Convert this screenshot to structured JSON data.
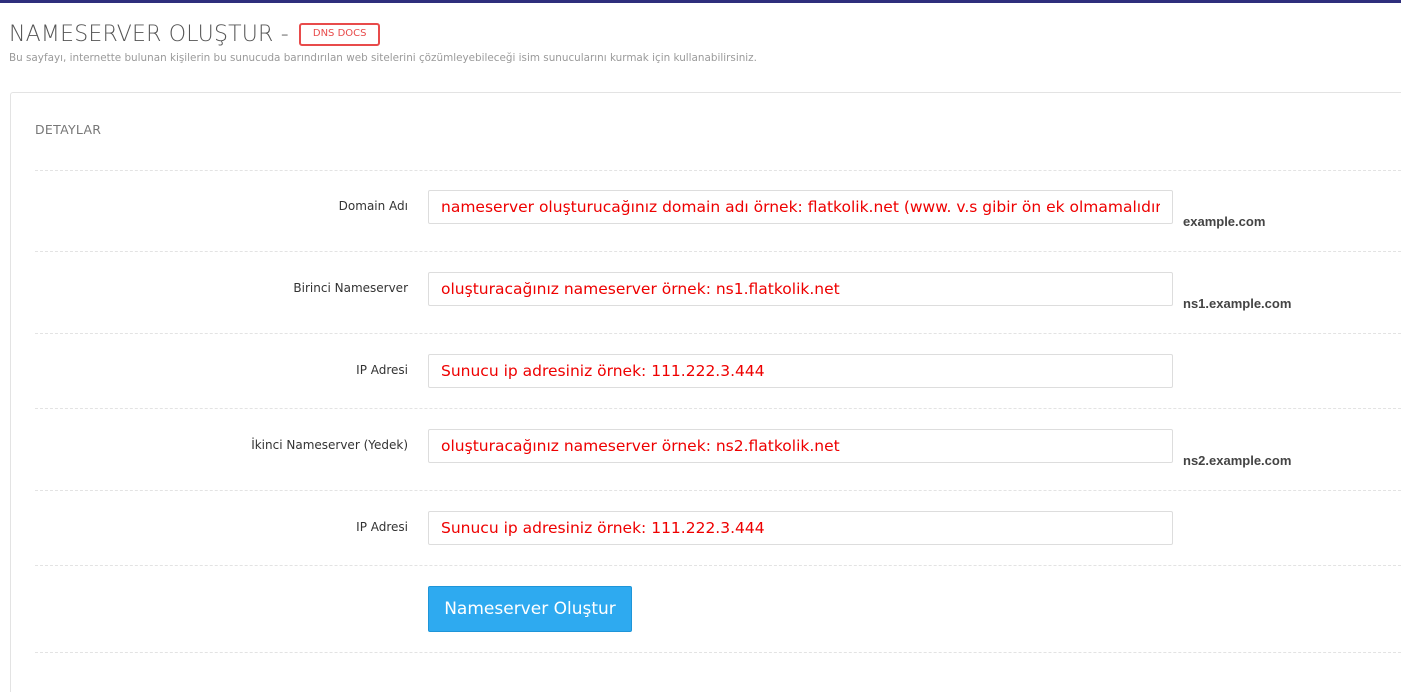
{
  "header": {
    "title": "NAMESERVER OLUŞTUR -",
    "badge_label": "DNS DOCS",
    "subtitle": "Bu sayfayı, internette bulunan kişilerin bu sunucuda barındırılan web sitelerini çözümleyebileceği isim sunucularını kurmak için kullanabilirsiniz."
  },
  "panel": {
    "heading": "DETAYLAR"
  },
  "form": {
    "fields": [
      {
        "label": "Domain Adı",
        "placeholder": "nameserver oluşturucağınız domain adı örnek: flatkolik.net (www. v.s gibir ön ek olmamalıdır).",
        "hint": "example.com"
      },
      {
        "label": "Birinci Nameserver",
        "placeholder": "oluşturacağınız nameserver örnek: ns1.flatkolik.net",
        "hint": "ns1.example.com"
      },
      {
        "label": "IP Adresi",
        "placeholder": "Sunucu ip adresiniz örnek: 111.222.3.444",
        "hint": ""
      },
      {
        "label": "İkinci Nameserver (Yedek)",
        "placeholder": "oluşturacağınız nameserver örnek: ns2.flatkolik.net",
        "hint": "ns2.example.com"
      },
      {
        "label": "IP Adresi",
        "placeholder": "Sunucu ip adresiniz örnek: 111.222.3.444",
        "hint": ""
      }
    ],
    "submit_label": "Nameserver Oluştur"
  },
  "colors": {
    "top_bar": "#2f2f7c",
    "badge": "#e84b4b",
    "placeholder_text": "#ee0000",
    "button": "#2eaaf0"
  }
}
